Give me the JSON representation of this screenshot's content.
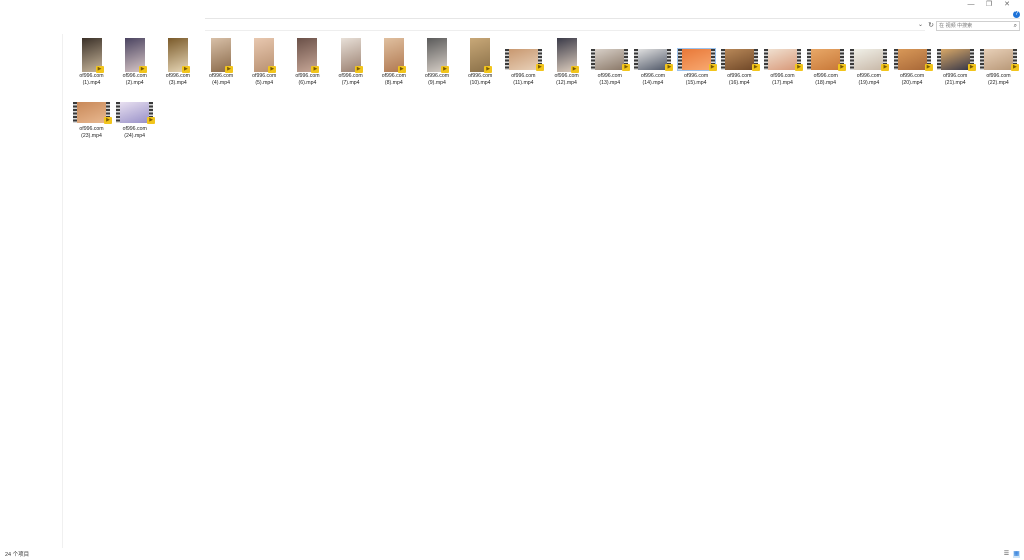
{
  "window": {
    "minimize_glyph": "—",
    "maximize_glyph": "❐",
    "close_glyph": "✕",
    "help_glyph": "?"
  },
  "address": {
    "dropdown_glyph": "⌄",
    "refresh_glyph": "↻",
    "search_placeholder": "在 视频 中搜索",
    "search_glyph": "⌕"
  },
  "files": [
    {
      "name": "of996.com (1).mp4",
      "orientation": "portrait",
      "colors": [
        "#3a3028",
        "#c9b79c"
      ]
    },
    {
      "name": "of996.com (2).mp4",
      "orientation": "portrait",
      "colors": [
        "#4a4360",
        "#d9c8c8"
      ]
    },
    {
      "name": "of996.com (3).mp4",
      "orientation": "portrait",
      "colors": [
        "#7a5a2a",
        "#e8d8b8"
      ]
    },
    {
      "name": "of996.com (4).mp4",
      "orientation": "portrait",
      "colors": [
        "#d8c0a8",
        "#8a6a4a"
      ]
    },
    {
      "name": "of996.com (5).mp4",
      "orientation": "portrait",
      "colors": [
        "#e8c8b0",
        "#b89070"
      ]
    },
    {
      "name": "of996.com (6).mp4",
      "orientation": "portrait",
      "colors": [
        "#6a5048",
        "#c8a898"
      ]
    },
    {
      "name": "of996.com (7).mp4",
      "orientation": "portrait",
      "colors": [
        "#e8e0d8",
        "#9a8070"
      ]
    },
    {
      "name": "of996.com (8).mp4",
      "orientation": "portrait",
      "colors": [
        "#e0c0a0",
        "#b07850"
      ]
    },
    {
      "name": "of996.com (9).mp4",
      "orientation": "portrait",
      "colors": [
        "#5a5a5a",
        "#d8d0c8"
      ]
    },
    {
      "name": "of996.com (10).mp4",
      "orientation": "portrait",
      "colors": [
        "#c8a878",
        "#8a7048"
      ]
    },
    {
      "name": "of996.com (11).mp4",
      "orientation": "landscape",
      "colors": [
        "#c89870",
        "#e8d0b8"
      ]
    },
    {
      "name": "of996.com (12).mp4",
      "orientation": "portrait",
      "colors": [
        "#3a3a48",
        "#e0d0c0"
      ]
    },
    {
      "name": "of996.com (13).mp4",
      "orientation": "landscape",
      "colors": [
        "#d8d0c8",
        "#8a7868"
      ]
    },
    {
      "name": "of996.com (14).mp4",
      "orientation": "landscape",
      "colors": [
        "#e0e0e0",
        "#505868"
      ]
    },
    {
      "name": "of996.com (15).mp4",
      "orientation": "landscape",
      "colors": [
        "#e87838",
        "#f8a870"
      ],
      "selected": true
    },
    {
      "name": "of996.com (16).mp4",
      "orientation": "landscape",
      "colors": [
        "#b88858",
        "#704828"
      ]
    },
    {
      "name": "of996.com (17).mp4",
      "orientation": "landscape",
      "colors": [
        "#f0e0d0",
        "#d89878"
      ]
    },
    {
      "name": "of996.com (18).mp4",
      "orientation": "landscape",
      "colors": [
        "#e8a868",
        "#c87838"
      ]
    },
    {
      "name": "of996.com (19).mp4",
      "orientation": "landscape",
      "colors": [
        "#f0f0e8",
        "#c8b8a8"
      ]
    },
    {
      "name": "of996.com (20).mp4",
      "orientation": "landscape",
      "colors": [
        "#d89858",
        "#a86838"
      ]
    },
    {
      "name": "of996.com (21).mp4",
      "orientation": "landscape",
      "colors": [
        "#d8a868",
        "#383848"
      ]
    },
    {
      "name": "of996.com (22).mp4",
      "orientation": "landscape",
      "colors": [
        "#e8d0b8",
        "#b89878"
      ]
    },
    {
      "name": "of996.com (23).mp4",
      "orientation": "landscape",
      "colors": [
        "#c88858",
        "#e8b890"
      ]
    },
    {
      "name": "of996.com (24).mp4",
      "orientation": "landscape",
      "colors": [
        "#e8e0f0",
        "#9890c8"
      ]
    }
  ],
  "badge_glyph": "▶",
  "status": {
    "item_count": "24 个项目"
  },
  "view": {
    "details_glyph": "☰",
    "thumbs_glyph": "▦"
  },
  "colors": {
    "selection": "#cce4f7",
    "badge": "#f2c51c",
    "help": "#1e73d8"
  }
}
